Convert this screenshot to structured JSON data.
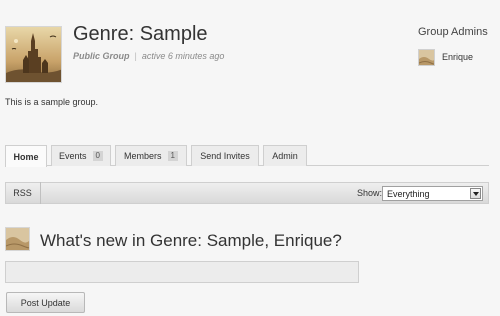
{
  "group": {
    "avatar": "castle-fantasy-image",
    "title": "Genre: Sample",
    "type": "Public Group",
    "separator": "|",
    "active": "active 6 minutes ago",
    "description": "This is a sample group."
  },
  "admins": {
    "heading": "Group Admins",
    "list": [
      {
        "name": "Enrique",
        "avatar": "sand-dunes-image"
      }
    ]
  },
  "tabs": [
    {
      "label": "Home",
      "count": null,
      "active": true
    },
    {
      "label": "Events",
      "count": "0",
      "active": false
    },
    {
      "label": "Members",
      "count": "1",
      "active": false
    },
    {
      "label": "Send Invites",
      "count": null,
      "active": false
    },
    {
      "label": "Admin",
      "count": null,
      "active": false
    }
  ],
  "filter": {
    "rss_label": "RSS",
    "show_label": "Show:",
    "selected": "Everything"
  },
  "whats_new": {
    "user_avatar": "sand-dunes-image",
    "heading": "What's new in Genre: Sample, Enrique?",
    "textarea_value": "",
    "post_button": "Post Update"
  },
  "colors": {
    "background": "#f6f6f6",
    "tab_bg": "#ececec",
    "border": "#cfcfcf"
  }
}
